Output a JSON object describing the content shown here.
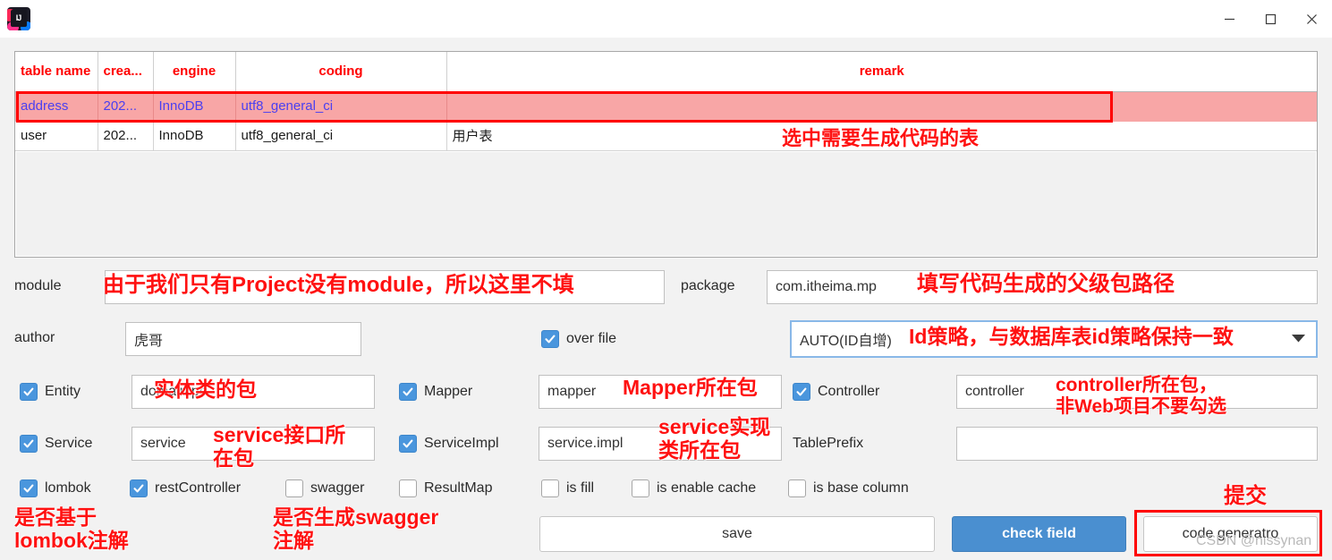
{
  "window": {
    "app_icon": "intellij-idea-icon",
    "controls": {
      "minimize": "minimize-icon",
      "maximize": "maximize-icon",
      "close": "close-icon"
    }
  },
  "table": {
    "columns": [
      "table name",
      "crea...",
      "engine",
      "coding",
      "remark"
    ],
    "rows": [
      {
        "selected": true,
        "cells": [
          "address",
          "202...",
          "InnoDB",
          "utf8_general_ci",
          ""
        ]
      },
      {
        "selected": false,
        "cells": [
          "user",
          "202...",
          "InnoDB",
          "utf8_general_ci",
          "用户表"
        ]
      }
    ]
  },
  "form": {
    "module": {
      "label": "module",
      "value": ""
    },
    "package": {
      "label": "package",
      "value": "com.itheima.mp"
    },
    "author": {
      "label": "author",
      "value": "虎哥"
    },
    "over_file": {
      "label": "over file",
      "checked": true
    },
    "id_strategy": {
      "value": "AUTO(ID自增)",
      "arrow": "chevron-down-icon"
    },
    "entity": {
      "label": "Entity",
      "checked": true,
      "value": "domain.po"
    },
    "mapper": {
      "label": "Mapper",
      "checked": true,
      "value": "mapper"
    },
    "controller": {
      "label": "Controller",
      "checked": true,
      "value": "controller"
    },
    "service": {
      "label": "Service",
      "checked": true,
      "value": "service"
    },
    "service_impl": {
      "label": "ServiceImpl",
      "checked": true,
      "value": "service.impl"
    },
    "table_prefix": {
      "label": "TablePrefix",
      "value": ""
    },
    "toggles": [
      {
        "label": "lombok",
        "checked": true
      },
      {
        "label": "restController",
        "checked": true
      },
      {
        "label": "swagger",
        "checked": false
      },
      {
        "label": "ResultMap",
        "checked": false
      }
    ],
    "flags": [
      {
        "label": "is fill",
        "checked": false
      },
      {
        "label": "is enable cache",
        "checked": false
      },
      {
        "label": "is base column",
        "checked": false
      }
    ]
  },
  "buttons": {
    "save": "save",
    "check_field": "check field",
    "code_generator": "code generatro"
  },
  "annotations": {
    "select_table": "选中需要生成代码的表",
    "module_note": "由于我们只有Project没有module，所以这里不填",
    "package_note": "填写代码生成的父级包路径",
    "id_note": "Id策略，与数据库表id策略保持一致",
    "entity_note": "实体类的包",
    "mapper_note": "Mapper所在包",
    "controller_note": "controller所在包，\n非Web项目不要勾选",
    "service_note": "service接口所\n在包",
    "service_impl_note": "service实现\n类所在包",
    "lombok_note": "是否基于\nlombok注解",
    "swagger_note": "是否生成swagger\n注解",
    "submit_note": "提交"
  },
  "watermark": {
    "text": "CSDN @nissynan"
  },
  "colors": {
    "accent_blue": "#4a8fd0",
    "checkbox_blue": "#4a96dd",
    "annotation_red": "#ff1111",
    "selected_row_bg": "#f8a6a6",
    "selected_row_text": "#4b3ff0",
    "header_text": "#ff0000",
    "panel_bg": "#f2f2f2"
  }
}
